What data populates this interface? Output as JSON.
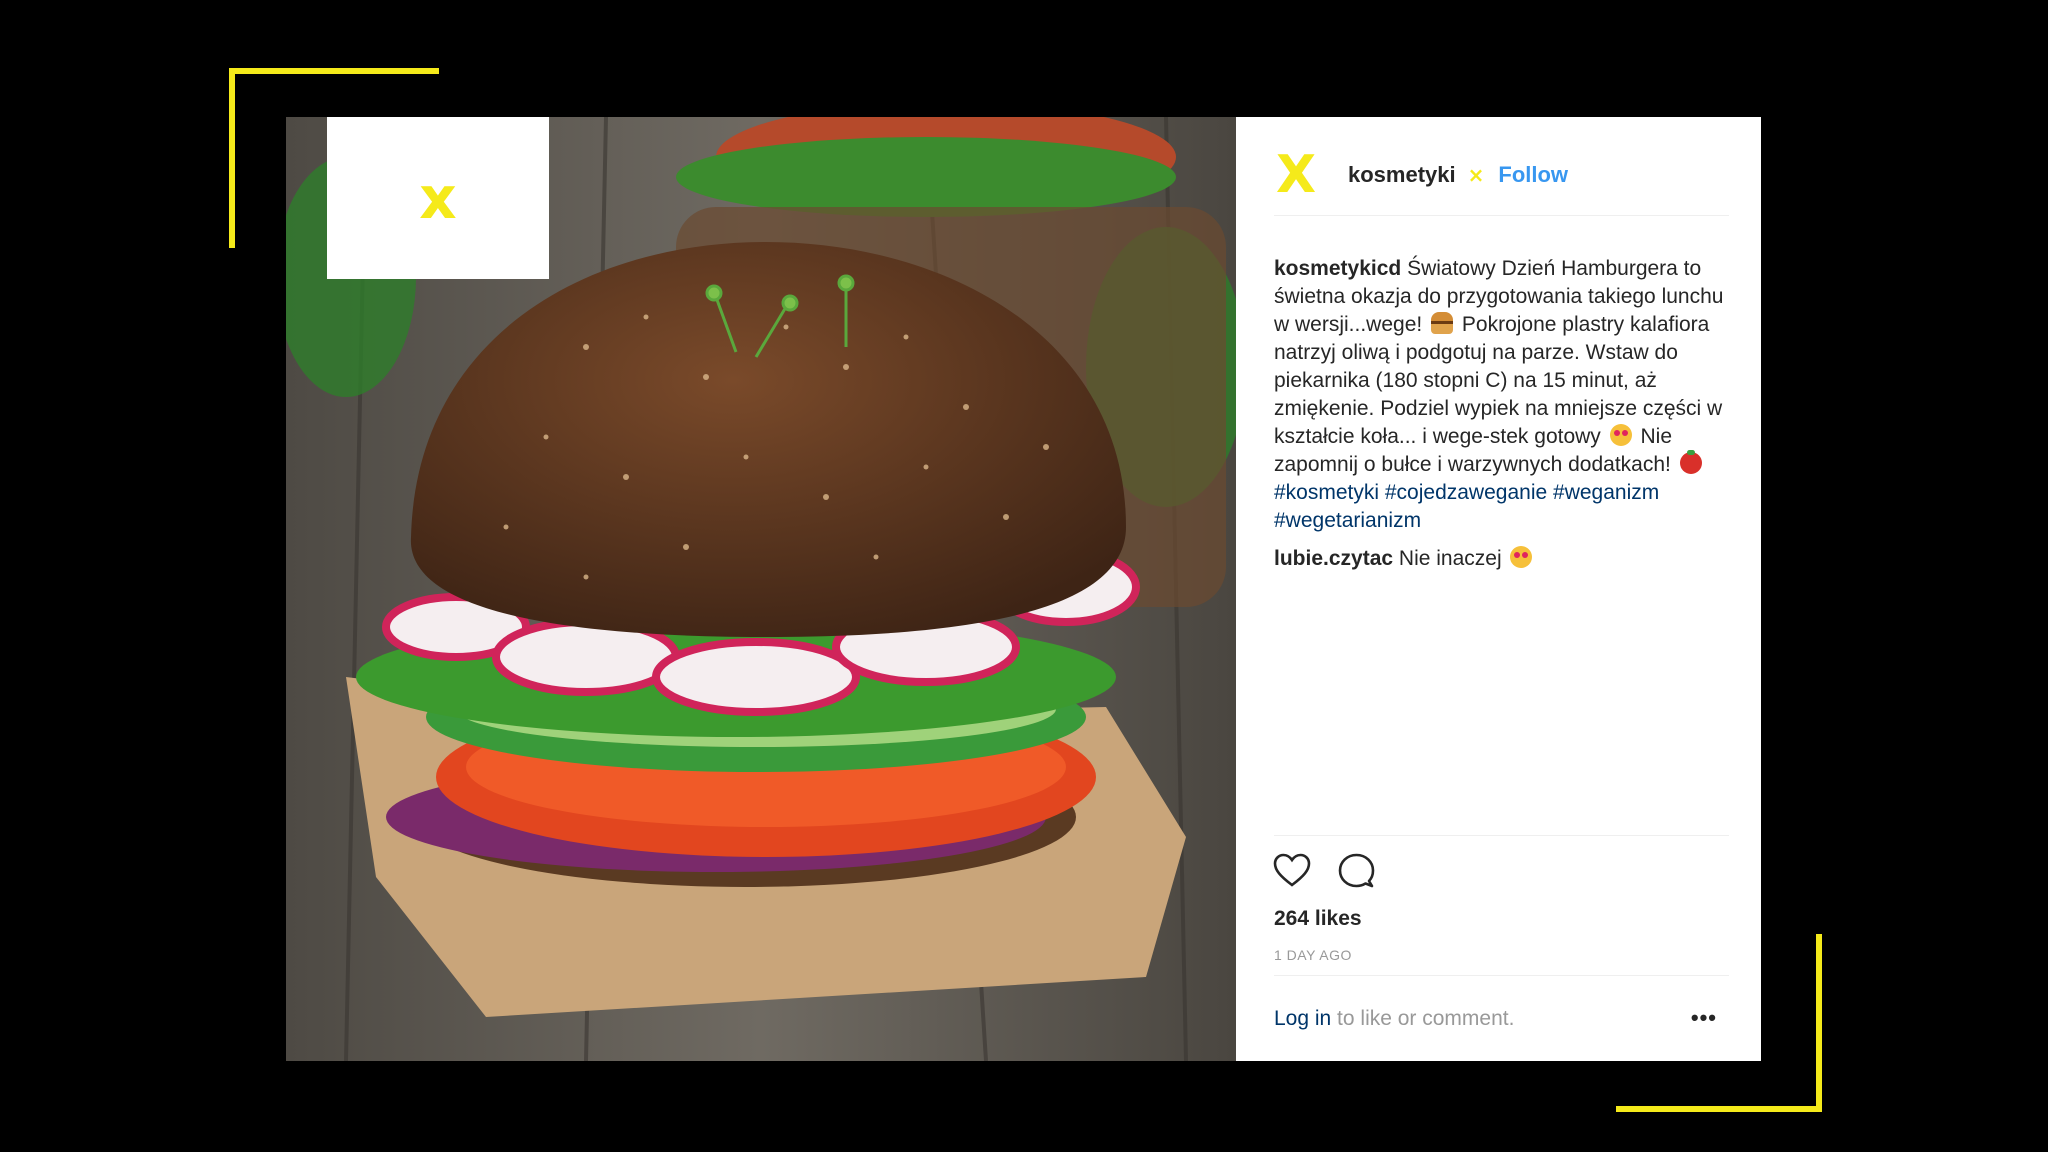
{
  "brand": {
    "accent_color": "#f5ea1a",
    "logo_glyph": "x",
    "avatar_glyph": "X",
    "verified_glyph": "×"
  },
  "post": {
    "username": "kosmetyki",
    "follow_label": "Follow",
    "caption": {
      "author": "kosmetykicd",
      "text_part1": " Światowy Dzień Hamburgera to świetna okazja do przygotowania takiego lunchu w wersji...wege!",
      "text_part2": " Pokrojone plastry kalafiora natrzyj oliwą i podgotuj na parze. Wstaw do piekarnika (180 stopni C) na 15 minut, aż zmiękenie. Podziel wypiek na mniejsze części w kształcie koła... i wege-stek gotowy",
      "text_part3": " Nie zapomnij o bułce i warzywnych dodatkach!",
      "hashtags": [
        "#kosmetyki",
        "#cojedzaweganie",
        "#weganizm",
        "#wegetarianizm"
      ],
      "emojis": [
        "burger",
        "heart-eyes",
        "tomato"
      ]
    },
    "comments": [
      {
        "author": "lubie.czytac",
        "text": " Nie inaczej",
        "emoji": "heart-eyes"
      }
    ],
    "likes": "264 likes",
    "timestamp": "1 DAY AGO",
    "login_link": "Log in",
    "login_rest": " to like or comment.",
    "more_label": "•••",
    "icons": [
      "heart-icon",
      "comment-icon",
      "more-options-icon"
    ]
  }
}
